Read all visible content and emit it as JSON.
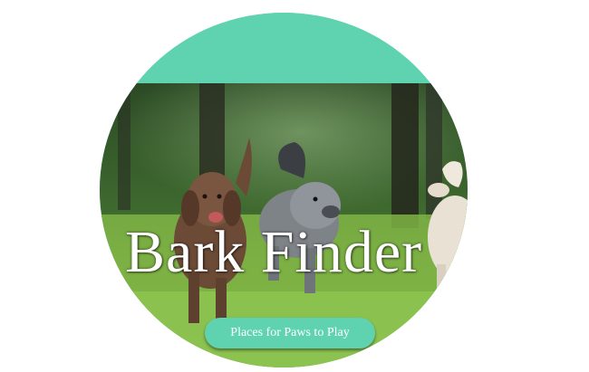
{
  "hero": {
    "title": "Bark Finder",
    "button_label": "Places for Paws to Play",
    "image_subject": "dogs running on grass"
  },
  "colors": {
    "accent": "#5fd3b0",
    "button": "#5fd3b0",
    "text": "#ffffff"
  }
}
